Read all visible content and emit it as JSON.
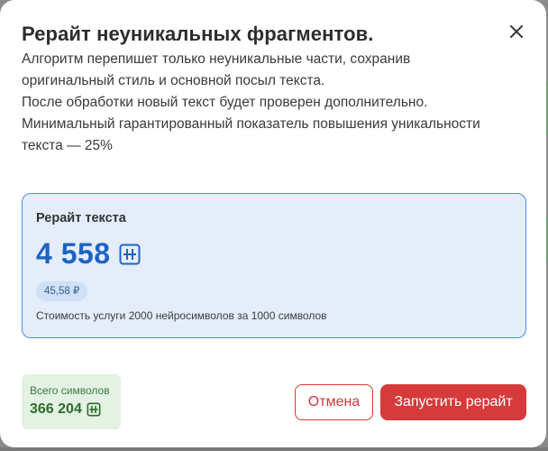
{
  "modal": {
    "title": "Рерайт неуникальных фрагментов.",
    "description_lines": [
      "Алгоритм перепишет только неуникальные части, сохранив",
      "оригинальный стиль и основной посыл текста.",
      "После обработки новый текст будет проверен дополнительно.",
      "Минимальный гарантированный показатель повышения уникальности",
      "текста — 25%"
    ],
    "close_icon": "close-icon"
  },
  "card": {
    "title": "Рерайт текста",
    "amount": "4 558",
    "amount_icon": "neuro-symbol-icon",
    "price": "45,58 ₽",
    "note": "Стоимость услуги 2000 нейросимволов за 1000 символов",
    "accent_color": "#1e63c3"
  },
  "total": {
    "label": "Всего символов",
    "value": "366 204",
    "icon": "neuro-symbol-icon"
  },
  "buttons": {
    "cancel": "Отмена",
    "run": "Запустить рерайт"
  },
  "colors": {
    "danger": "#d63b3b",
    "card_bg": "#e4edf9",
    "total_bg": "#e3f2e3"
  }
}
